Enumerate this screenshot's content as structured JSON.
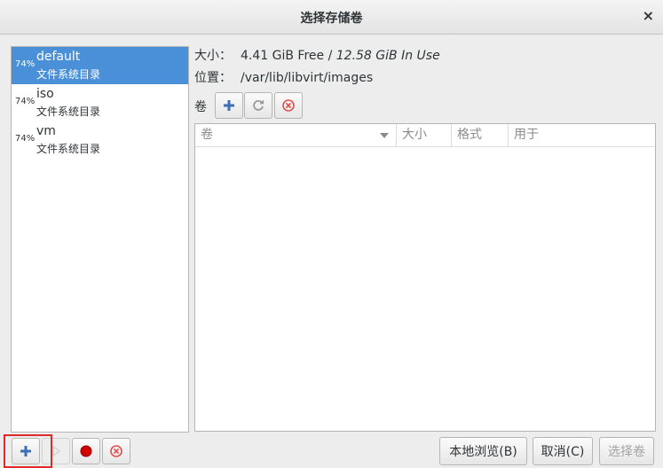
{
  "window": {
    "title": "选择存储卷",
    "close_glyph": "×"
  },
  "pools": [
    {
      "pct": "74%",
      "name": "default",
      "type": "文件系统目录",
      "selected": true
    },
    {
      "pct": "74%",
      "name": "iso",
      "type": "文件系统目录",
      "selected": false
    },
    {
      "pct": "74%",
      "name": "vm",
      "type": "文件系统目录",
      "selected": false
    }
  ],
  "info": {
    "size_label": "大小：",
    "size_free": "4.41 GiB Free / ",
    "size_inuse": "12.58 GiB In Use",
    "location_label": "位置：",
    "location_value": "/var/lib/libvirt/images"
  },
  "volumes": {
    "label": "卷",
    "columns": [
      "卷",
      "大小",
      "格式",
      "用于"
    ],
    "rows": []
  },
  "buttons": {
    "browse_local": "本地浏览(B)",
    "cancel": "取消(C)",
    "choose_volume": "选择卷"
  },
  "colors": {
    "selection": "#4a90d9",
    "add_icon": "#3b6fb6",
    "stop_icon": "#d40000",
    "delete_icon": "#e05050",
    "annotation": "#e02a2a"
  }
}
